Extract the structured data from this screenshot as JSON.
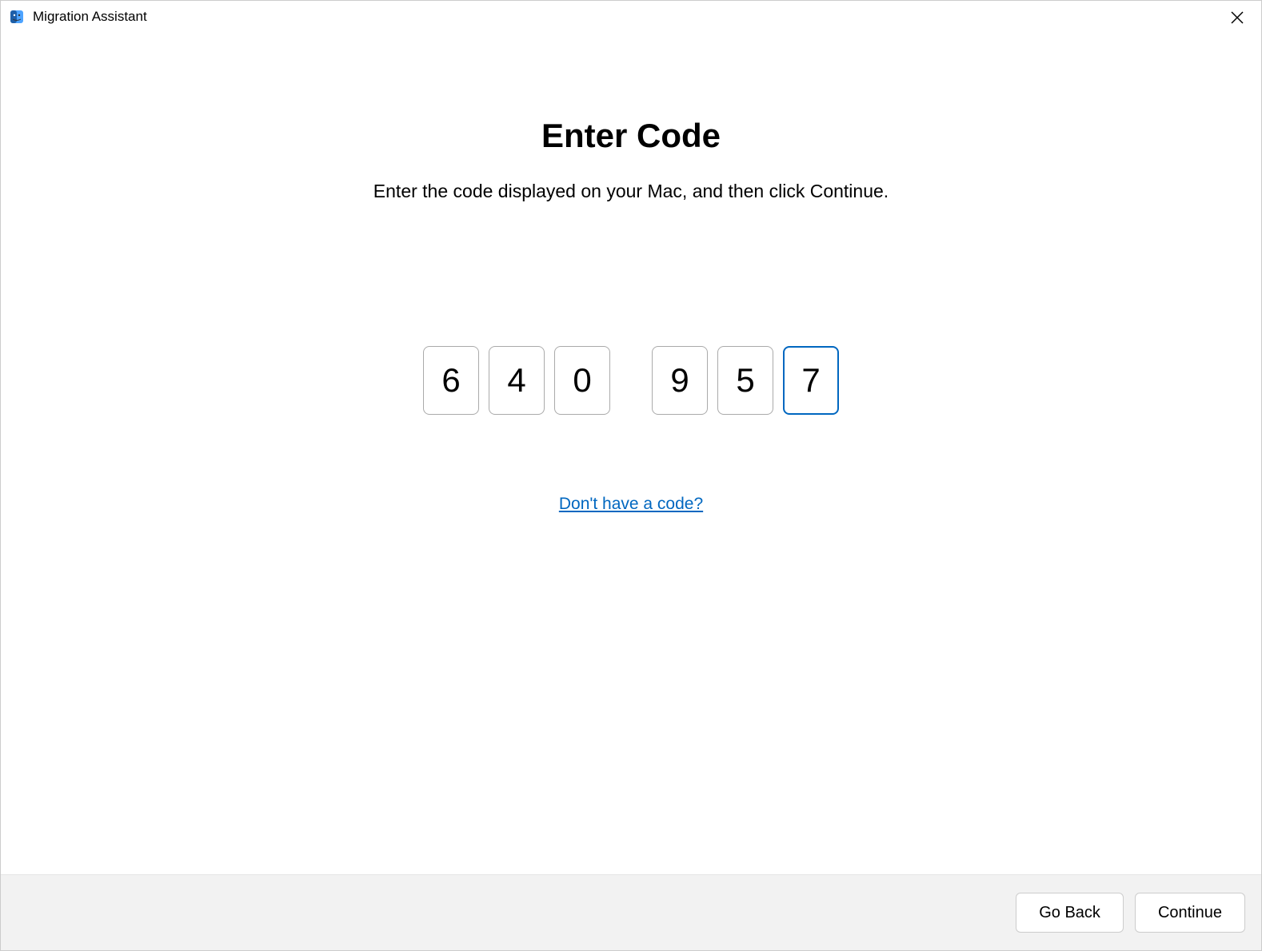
{
  "titlebar": {
    "title": "Migration Assistant",
    "icon_name": "migration-assistant-icon"
  },
  "main": {
    "heading": "Enter Code",
    "instruction": "Enter the code displayed on your Mac, and then click Continue.",
    "code_digits": [
      "6",
      "4",
      "0",
      "9",
      "5",
      "7"
    ],
    "focused_index": 5,
    "help_link": "Don't have a code?"
  },
  "footer": {
    "go_back_label": "Go Back",
    "continue_label": "Continue"
  }
}
